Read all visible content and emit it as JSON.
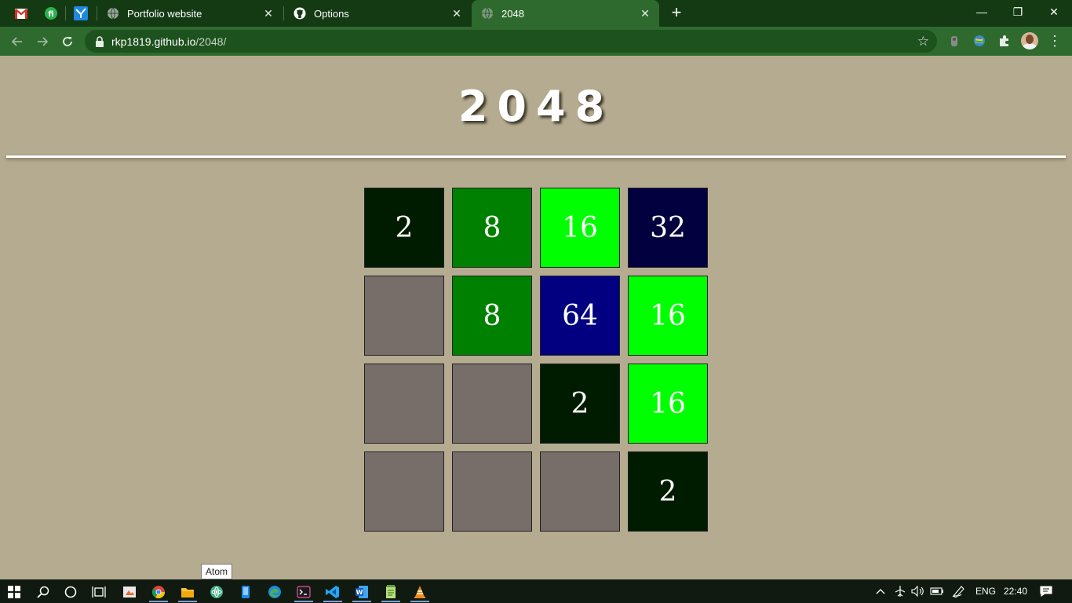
{
  "browser": {
    "pinned_tabs": [
      {
        "name": "gmail-icon"
      },
      {
        "name": "feedly-icon"
      },
      {
        "name": "hummingbird-icon"
      }
    ],
    "tabs": [
      {
        "title": "Portfolio website",
        "icon": "globe-icon",
        "active": false
      },
      {
        "title": "Options",
        "icon": "github-icon",
        "active": false
      },
      {
        "title": "2048",
        "icon": "globe-icon",
        "active": true
      }
    ],
    "url_host": "rkp1819.github.io",
    "url_path": "/2048/",
    "window_controls": {
      "minimize": "—",
      "restore": "❐",
      "close": "✕"
    },
    "colors": {
      "frame": "#143a14",
      "toolbar": "#2e6a2e"
    }
  },
  "game": {
    "title": "2048",
    "board": [
      [
        "2",
        "8",
        "16",
        "32"
      ],
      [
        "",
        "8",
        "64",
        "16"
      ],
      [
        "",
        "",
        "2",
        "16"
      ],
      [
        "",
        "",
        "",
        "2"
      ]
    ],
    "tile_colors": {
      "empty": "#776d69",
      "2": "#001c00",
      "8": "#008000",
      "16": "#00ff00",
      "32": "#02003e",
      "64": "#020080"
    },
    "page_background": "#b5ab90"
  },
  "tooltip": "Atom",
  "taskbar": {
    "icons": [
      "windows-start-icon",
      "search-icon",
      "cortana-icon",
      "task-view-icon",
      "photos-icon",
      "chrome-icon",
      "file-explorer-icon",
      "atom-icon",
      "phone-icon",
      "edge-icon",
      "terminal-icon",
      "vscode-icon",
      "word-icon",
      "notepad-icon",
      "vlc-icon"
    ],
    "language": "ENG",
    "time": "22:40"
  }
}
